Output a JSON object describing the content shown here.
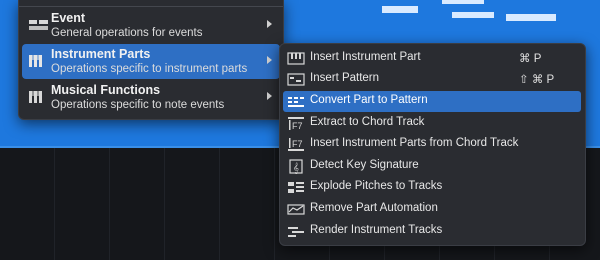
{
  "left_menu": {
    "items": [
      {
        "title": "Event",
        "subtitle": "General operations for events",
        "icon": "event-icon",
        "active": false
      },
      {
        "title": "Instrument Parts",
        "subtitle": "Operations specific to instrument parts",
        "icon": "instrument-parts-icon",
        "active": true
      },
      {
        "title": "Musical Functions",
        "subtitle": "Operations specific to note events",
        "icon": "musical-functions-icon",
        "active": false
      }
    ]
  },
  "submenu": {
    "items": [
      {
        "label": "Insert Instrument Part",
        "shortcut": "⌘ P",
        "icon": "piano-keys-icon"
      },
      {
        "label": "Insert Pattern",
        "shortcut": "⇧ ⌘ P",
        "icon": "pattern-icon"
      },
      {
        "label": "Convert Part to Pattern",
        "shortcut": "",
        "icon": "convert-pattern-icon",
        "active": true
      },
      {
        "label": "Extract to Chord Track",
        "shortcut": "",
        "icon": "chord-extract-icon"
      },
      {
        "label": "Insert Instrument Parts from Chord Track",
        "shortcut": "",
        "icon": "chord-insert-icon"
      },
      {
        "label": "Detect Key Signature",
        "shortcut": "",
        "icon": "key-signature-icon"
      },
      {
        "label": "Explode Pitches to Tracks",
        "shortcut": "",
        "icon": "explode-pitches-icon"
      },
      {
        "label": "Remove Part Automation",
        "shortcut": "",
        "icon": "remove-automation-icon"
      },
      {
        "label": "Render Instrument Tracks",
        "shortcut": "",
        "icon": "render-tracks-icon"
      }
    ]
  },
  "colors": {
    "accent": "#2e6fc4",
    "menu_bg": "#2a2c31",
    "timeline_blue": "#1e78de"
  }
}
